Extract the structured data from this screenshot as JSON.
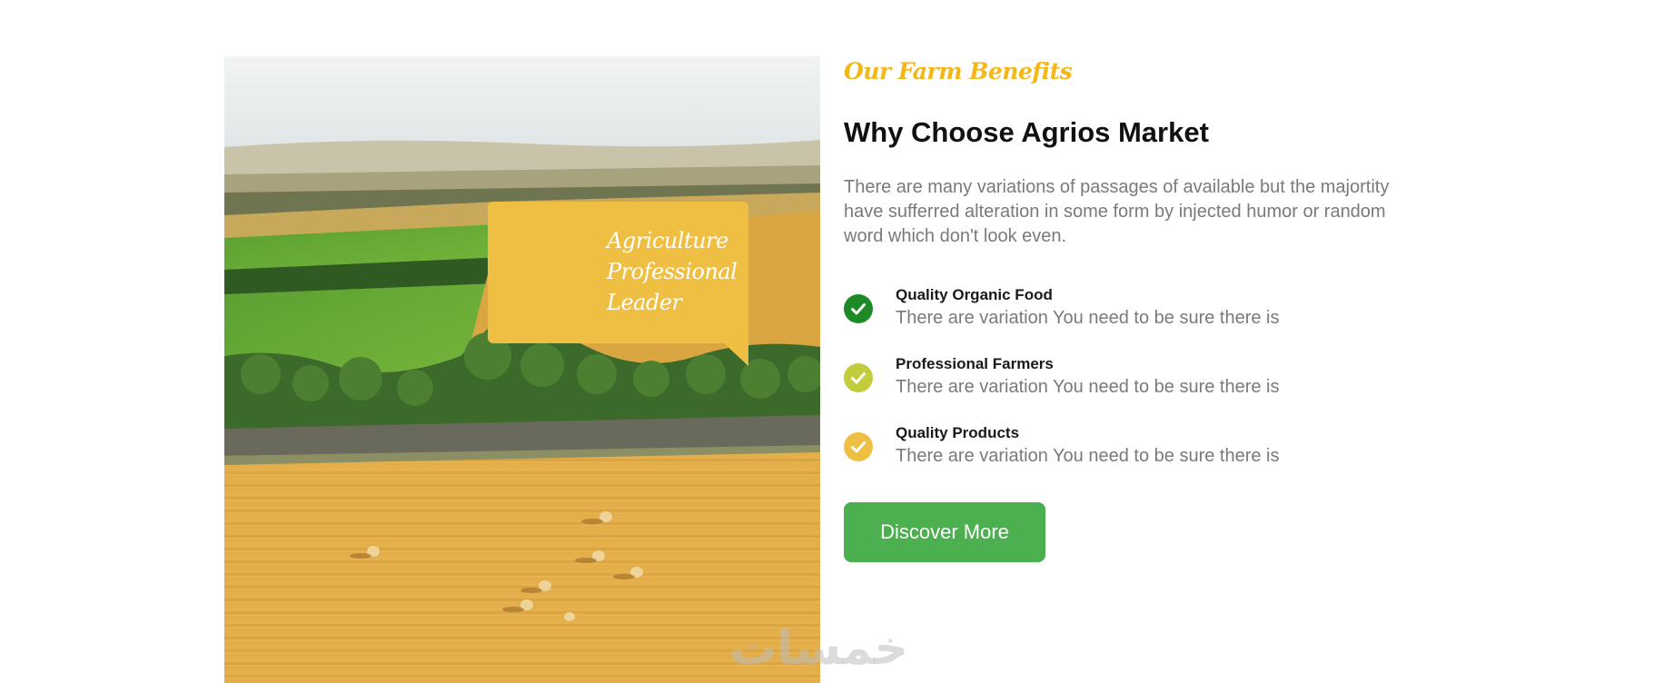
{
  "callout": {
    "lines": [
      "Agriculture",
      "Professional",
      "Leader"
    ]
  },
  "section": {
    "eyebrow": "Our Farm Benefits",
    "heading": "Why Choose Agrios Market",
    "description": "There are many variations of passages of available but the majortity have sufferred alteration in some form by injected humor or random word which don't look even."
  },
  "features": [
    {
      "title": "Quality Organic Food",
      "text": "There are variation You need to be sure there is",
      "icon": "check-icon",
      "color": "#1e8a26"
    },
    {
      "title": "Professional Farmers",
      "text": "There are variation You need to be sure there is",
      "icon": "check-icon",
      "color": "#c3cc3a"
    },
    {
      "title": "Quality Products",
      "text": "There are variation You need to be sure there is",
      "icon": "check-icon",
      "color": "#efbf43"
    }
  ],
  "cta": {
    "label": "Discover More"
  },
  "watermark": {
    "text": "خمسات"
  },
  "colors": {
    "accent_yellow": "#f5b716",
    "callout_bg": "#efbf43",
    "button_green": "#4caf50",
    "heading": "#111111",
    "body_text": "#7a7a7a"
  }
}
